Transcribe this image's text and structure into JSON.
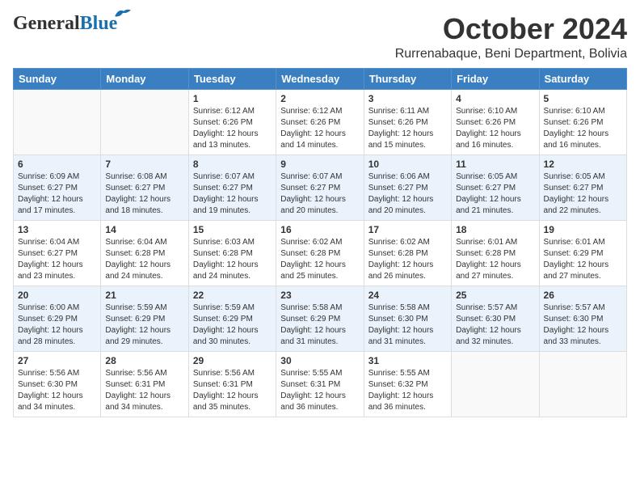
{
  "header": {
    "logo_general": "General",
    "logo_blue": "Blue",
    "month": "October 2024",
    "location": "Rurrenabaque, Beni Department, Bolivia"
  },
  "days_of_week": [
    "Sunday",
    "Monday",
    "Tuesday",
    "Wednesday",
    "Thursday",
    "Friday",
    "Saturday"
  ],
  "weeks": [
    [
      {
        "day": "",
        "sunrise": "",
        "sunset": "",
        "daylight": ""
      },
      {
        "day": "",
        "sunrise": "",
        "sunset": "",
        "daylight": ""
      },
      {
        "day": "1",
        "sunrise": "Sunrise: 6:12 AM",
        "sunset": "Sunset: 6:26 PM",
        "daylight": "Daylight: 12 hours and 13 minutes."
      },
      {
        "day": "2",
        "sunrise": "Sunrise: 6:12 AM",
        "sunset": "Sunset: 6:26 PM",
        "daylight": "Daylight: 12 hours and 14 minutes."
      },
      {
        "day": "3",
        "sunrise": "Sunrise: 6:11 AM",
        "sunset": "Sunset: 6:26 PM",
        "daylight": "Daylight: 12 hours and 15 minutes."
      },
      {
        "day": "4",
        "sunrise": "Sunrise: 6:10 AM",
        "sunset": "Sunset: 6:26 PM",
        "daylight": "Daylight: 12 hours and 16 minutes."
      },
      {
        "day": "5",
        "sunrise": "Sunrise: 6:10 AM",
        "sunset": "Sunset: 6:26 PM",
        "daylight": "Daylight: 12 hours and 16 minutes."
      }
    ],
    [
      {
        "day": "6",
        "sunrise": "Sunrise: 6:09 AM",
        "sunset": "Sunset: 6:27 PM",
        "daylight": "Daylight: 12 hours and 17 minutes."
      },
      {
        "day": "7",
        "sunrise": "Sunrise: 6:08 AM",
        "sunset": "Sunset: 6:27 PM",
        "daylight": "Daylight: 12 hours and 18 minutes."
      },
      {
        "day": "8",
        "sunrise": "Sunrise: 6:07 AM",
        "sunset": "Sunset: 6:27 PM",
        "daylight": "Daylight: 12 hours and 19 minutes."
      },
      {
        "day": "9",
        "sunrise": "Sunrise: 6:07 AM",
        "sunset": "Sunset: 6:27 PM",
        "daylight": "Daylight: 12 hours and 20 minutes."
      },
      {
        "day": "10",
        "sunrise": "Sunrise: 6:06 AM",
        "sunset": "Sunset: 6:27 PM",
        "daylight": "Daylight: 12 hours and 20 minutes."
      },
      {
        "day": "11",
        "sunrise": "Sunrise: 6:05 AM",
        "sunset": "Sunset: 6:27 PM",
        "daylight": "Daylight: 12 hours and 21 minutes."
      },
      {
        "day": "12",
        "sunrise": "Sunrise: 6:05 AM",
        "sunset": "Sunset: 6:27 PM",
        "daylight": "Daylight: 12 hours and 22 minutes."
      }
    ],
    [
      {
        "day": "13",
        "sunrise": "Sunrise: 6:04 AM",
        "sunset": "Sunset: 6:27 PM",
        "daylight": "Daylight: 12 hours and 23 minutes."
      },
      {
        "day": "14",
        "sunrise": "Sunrise: 6:04 AM",
        "sunset": "Sunset: 6:28 PM",
        "daylight": "Daylight: 12 hours and 24 minutes."
      },
      {
        "day": "15",
        "sunrise": "Sunrise: 6:03 AM",
        "sunset": "Sunset: 6:28 PM",
        "daylight": "Daylight: 12 hours and 24 minutes."
      },
      {
        "day": "16",
        "sunrise": "Sunrise: 6:02 AM",
        "sunset": "Sunset: 6:28 PM",
        "daylight": "Daylight: 12 hours and 25 minutes."
      },
      {
        "day": "17",
        "sunrise": "Sunrise: 6:02 AM",
        "sunset": "Sunset: 6:28 PM",
        "daylight": "Daylight: 12 hours and 26 minutes."
      },
      {
        "day": "18",
        "sunrise": "Sunrise: 6:01 AM",
        "sunset": "Sunset: 6:28 PM",
        "daylight": "Daylight: 12 hours and 27 minutes."
      },
      {
        "day": "19",
        "sunrise": "Sunrise: 6:01 AM",
        "sunset": "Sunset: 6:29 PM",
        "daylight": "Daylight: 12 hours and 27 minutes."
      }
    ],
    [
      {
        "day": "20",
        "sunrise": "Sunrise: 6:00 AM",
        "sunset": "Sunset: 6:29 PM",
        "daylight": "Daylight: 12 hours and 28 minutes."
      },
      {
        "day": "21",
        "sunrise": "Sunrise: 5:59 AM",
        "sunset": "Sunset: 6:29 PM",
        "daylight": "Daylight: 12 hours and 29 minutes."
      },
      {
        "day": "22",
        "sunrise": "Sunrise: 5:59 AM",
        "sunset": "Sunset: 6:29 PM",
        "daylight": "Daylight: 12 hours and 30 minutes."
      },
      {
        "day": "23",
        "sunrise": "Sunrise: 5:58 AM",
        "sunset": "Sunset: 6:29 PM",
        "daylight": "Daylight: 12 hours and 31 minutes."
      },
      {
        "day": "24",
        "sunrise": "Sunrise: 5:58 AM",
        "sunset": "Sunset: 6:30 PM",
        "daylight": "Daylight: 12 hours and 31 minutes."
      },
      {
        "day": "25",
        "sunrise": "Sunrise: 5:57 AM",
        "sunset": "Sunset: 6:30 PM",
        "daylight": "Daylight: 12 hours and 32 minutes."
      },
      {
        "day": "26",
        "sunrise": "Sunrise: 5:57 AM",
        "sunset": "Sunset: 6:30 PM",
        "daylight": "Daylight: 12 hours and 33 minutes."
      }
    ],
    [
      {
        "day": "27",
        "sunrise": "Sunrise: 5:56 AM",
        "sunset": "Sunset: 6:30 PM",
        "daylight": "Daylight: 12 hours and 34 minutes."
      },
      {
        "day": "28",
        "sunrise": "Sunrise: 5:56 AM",
        "sunset": "Sunset: 6:31 PM",
        "daylight": "Daylight: 12 hours and 34 minutes."
      },
      {
        "day": "29",
        "sunrise": "Sunrise: 5:56 AM",
        "sunset": "Sunset: 6:31 PM",
        "daylight": "Daylight: 12 hours and 35 minutes."
      },
      {
        "day": "30",
        "sunrise": "Sunrise: 5:55 AM",
        "sunset": "Sunset: 6:31 PM",
        "daylight": "Daylight: 12 hours and 36 minutes."
      },
      {
        "day": "31",
        "sunrise": "Sunrise: 5:55 AM",
        "sunset": "Sunset: 6:32 PM",
        "daylight": "Daylight: 12 hours and 36 minutes."
      },
      {
        "day": "",
        "sunrise": "",
        "sunset": "",
        "daylight": ""
      },
      {
        "day": "",
        "sunrise": "",
        "sunset": "",
        "daylight": ""
      }
    ]
  ]
}
